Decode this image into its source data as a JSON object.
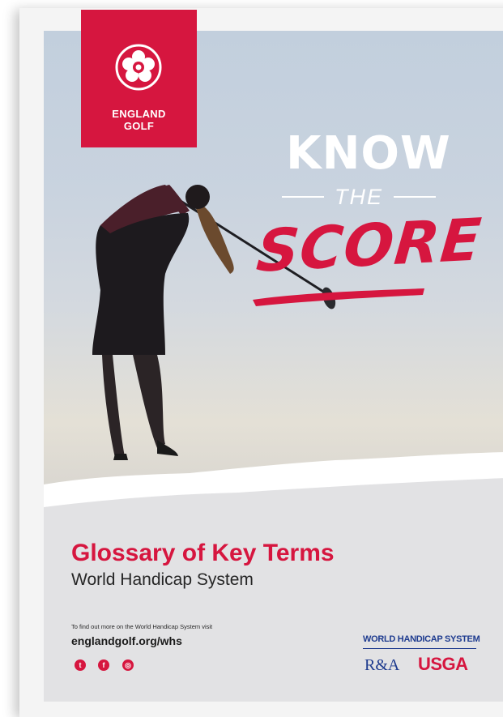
{
  "brand": {
    "name_line1": "ENGLAND",
    "name_line2": "GOLF",
    "logo_icon": "tudor-rose-icon",
    "colors": {
      "red": "#d6163f",
      "navy": "#1e3b8f"
    }
  },
  "headline": {
    "line1": "KNOW",
    "line2": "THE",
    "line3": "SCORE"
  },
  "document": {
    "title": "Glossary of Key Terms",
    "subtitle": "World Handicap System"
  },
  "footer": {
    "info_text": "To find out more on the World Handicap System visit",
    "url": "englandgolf.org/whs",
    "social_icons": [
      "twitter-icon",
      "facebook-icon",
      "instagram-icon"
    ],
    "partner_program": "WORLD HANDICAP SYSTEM",
    "partner_1": "R&A",
    "partner_2": "USGA"
  }
}
